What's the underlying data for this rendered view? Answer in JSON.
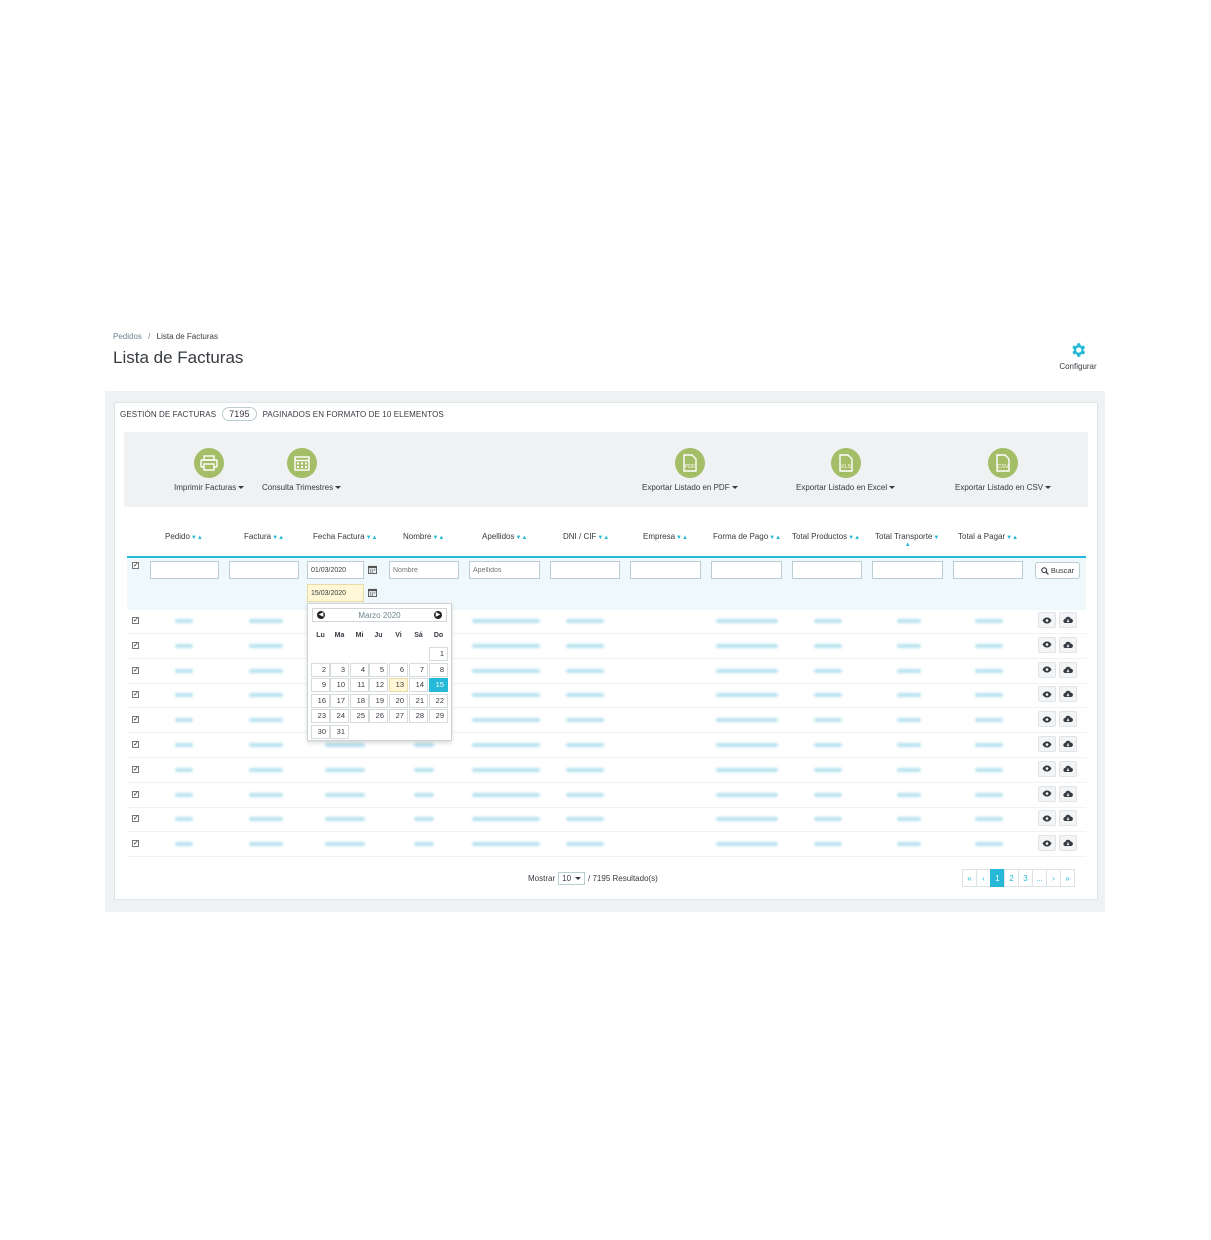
{
  "breadcrumb": {
    "parent": "Pedidos",
    "separator": "/",
    "current": "Lista de Facturas"
  },
  "page_title": "Lista de Facturas",
  "configure_label": "Configurar",
  "panel": {
    "title": "GESTIÓN DE FACTURAS",
    "count": "7195",
    "subtitle": "PAGINADOS EN FORMATO DE 10 ELEMENTOS"
  },
  "toolbar": {
    "print_label": "Imprimir Facturas",
    "quarters_label": "Consulta Trimestres",
    "pdf_label": "Exportar Listado en PDF",
    "pdf_badge": "PDF",
    "excel_label": "Exportar Listado en Excel",
    "excel_badge": "XLS",
    "csv_label": "Exportar Listado en CSV",
    "csv_badge": "CSV"
  },
  "columns": {
    "pedido": "Pedido",
    "factura": "Factura",
    "fecha": "Fecha Factura",
    "nombre": "Nombre",
    "apellidos": "Apellidos",
    "dni": "DNI / CIF",
    "empresa": "Empresa",
    "forma_pago": "Forma de Pago",
    "total_productos": "Total Productos",
    "total_transporte": "Total Transporte",
    "total_pagar": "Total a Pagar"
  },
  "filters": {
    "date_from": "01/03/2020",
    "date_to": "15/03/2020",
    "nombre_placeholder": "Nombre",
    "apellidos_placeholder": "Apellidos",
    "search_label": "Buscar"
  },
  "datepicker": {
    "month_label": "Marzo 2020",
    "weekdays": [
      "Lu",
      "Ma",
      "Mi",
      "Ju",
      "Vi",
      "Sá",
      "Do"
    ],
    "days": [
      "1",
      "2",
      "3",
      "4",
      "5",
      "6",
      "7",
      "8",
      "9",
      "10",
      "11",
      "12",
      "13",
      "14",
      "15",
      "16",
      "17",
      "18",
      "19",
      "20",
      "21",
      "22",
      "23",
      "24",
      "25",
      "26",
      "27",
      "28",
      "29",
      "30",
      "31"
    ],
    "today": "13",
    "selected": "15"
  },
  "footer": {
    "show_label": "Mostrar",
    "per_page": "10",
    "results": "/ 7195 Resultado(s)"
  },
  "pagination": [
    "«",
    "‹",
    "1",
    "2",
    "3",
    "...",
    "›",
    "»"
  ],
  "colors": {
    "accent": "#25b9d7",
    "icon_green": "#a4bd67",
    "today_bg": "#fff7d6"
  }
}
